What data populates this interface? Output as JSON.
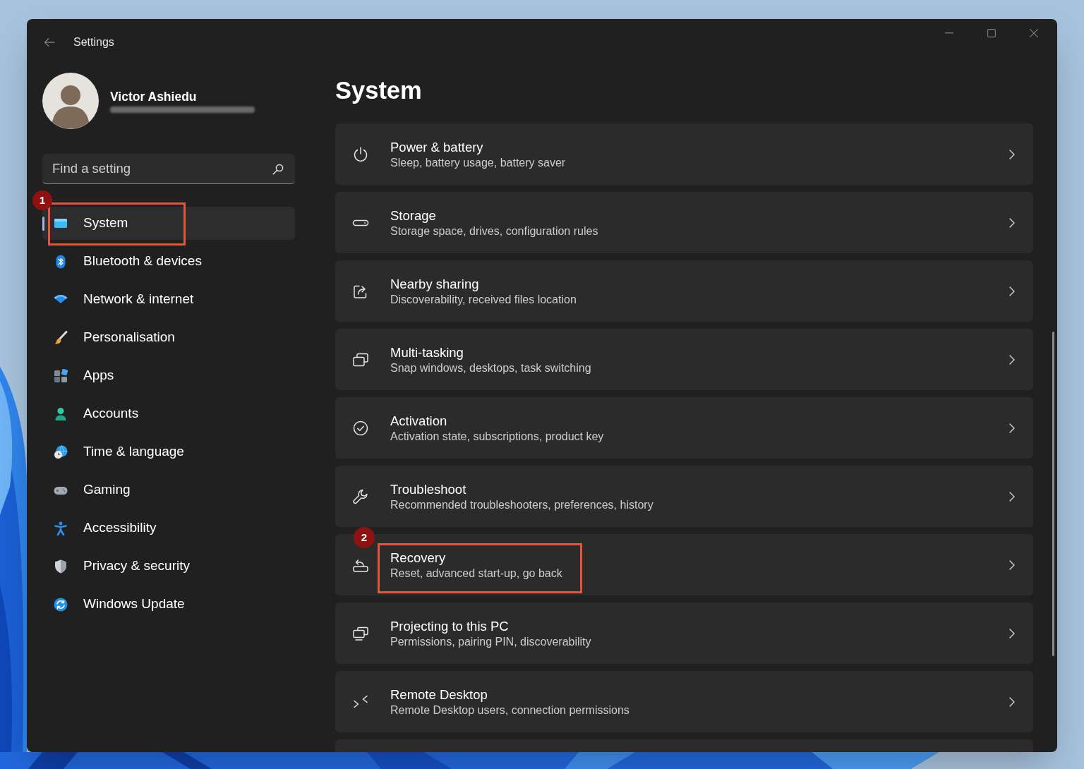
{
  "window": {
    "title": "Settings"
  },
  "account": {
    "name": "Victor Ashiedu",
    "email_blurred": true
  },
  "search": {
    "placeholder": "Find a setting"
  },
  "sidebar": {
    "items": [
      {
        "label": "System",
        "selected": true,
        "callout": "1"
      },
      {
        "label": "Bluetooth & devices",
        "selected": false
      },
      {
        "label": "Network & internet",
        "selected": false
      },
      {
        "label": "Personalisation",
        "selected": false
      },
      {
        "label": "Apps",
        "selected": false
      },
      {
        "label": "Accounts",
        "selected": false
      },
      {
        "label": "Time & language",
        "selected": false
      },
      {
        "label": "Gaming",
        "selected": false
      },
      {
        "label": "Accessibility",
        "selected": false
      },
      {
        "label": "Privacy & security",
        "selected": false
      },
      {
        "label": "Windows Update",
        "selected": false
      }
    ]
  },
  "page": {
    "title": "System",
    "cards": [
      {
        "title": "Power & battery",
        "subtitle": "Sleep, battery usage, battery saver"
      },
      {
        "title": "Storage",
        "subtitle": "Storage space, drives, configuration rules"
      },
      {
        "title": "Nearby sharing",
        "subtitle": "Discoverability, received files location"
      },
      {
        "title": "Multi-tasking",
        "subtitle": "Snap windows, desktops, task switching"
      },
      {
        "title": "Activation",
        "subtitle": "Activation state, subscriptions, product key"
      },
      {
        "title": "Troubleshoot",
        "subtitle": "Recommended troubleshooters, preferences, history"
      },
      {
        "title": "Recovery",
        "subtitle": "Reset, advanced start-up, go back",
        "callout": "2"
      },
      {
        "title": "Projecting to this PC",
        "subtitle": "Permissions, pairing PIN, discoverability"
      },
      {
        "title": "Remote Desktop",
        "subtitle": "Remote Desktop users, connection permissions"
      }
    ]
  }
}
